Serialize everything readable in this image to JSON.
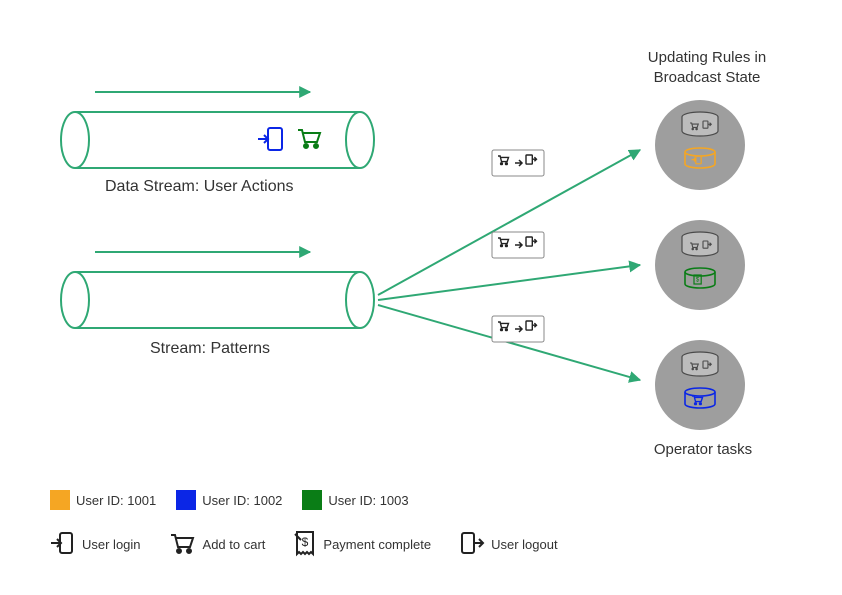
{
  "titles": {
    "top_right": "Updating Rules in Broadcast State",
    "bottom_right": "Operator tasks"
  },
  "streams": {
    "user_actions_label": "Data Stream: User Actions",
    "patterns_label": "Stream: Patterns"
  },
  "legend_users": [
    {
      "color": "#f5a623",
      "label": "User ID: 1001"
    },
    {
      "color": "#0b26e6",
      "label": "User ID: 1002"
    },
    {
      "color": "#0a7d16",
      "label": "User ID: 1003"
    }
  ],
  "legend_actions": {
    "login": "User login",
    "add_cart": "Add to cart",
    "payment": "Payment complete",
    "logout": "User logout"
  },
  "colors": {
    "stream_stroke": "#2fa874",
    "arrow": "#2fa874",
    "node_bg": "#9e9e9e",
    "db_fill": "#bcbcbc",
    "db_stroke": "#4a4a4a",
    "icon_black": "#222",
    "user1": "#f5a623",
    "user2": "#0b26e6",
    "user3": "#0a7d16"
  }
}
